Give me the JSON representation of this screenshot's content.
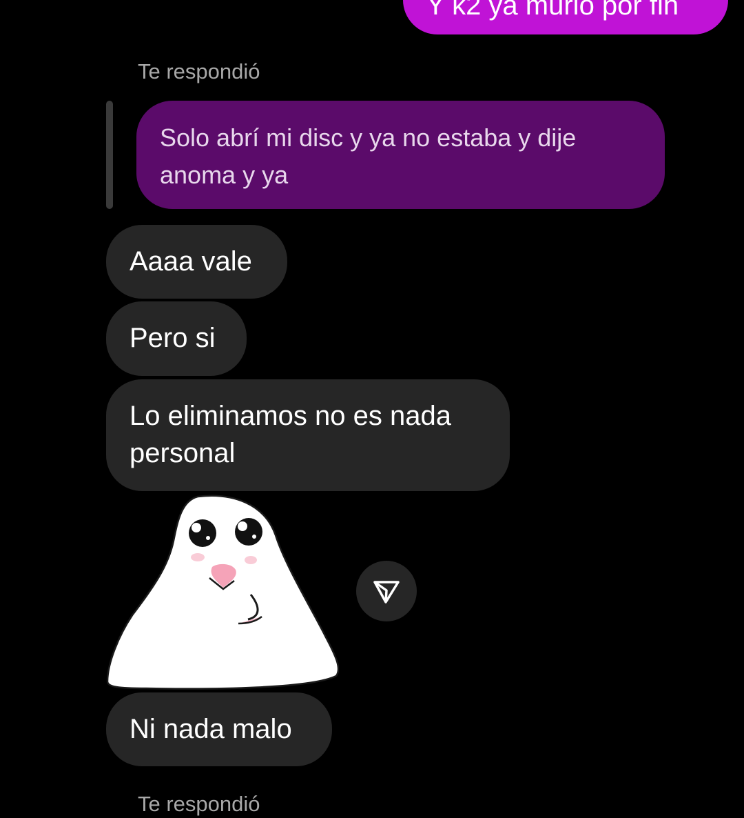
{
  "thread": {
    "sent_top_partial": "Y k2 ya murió por fin",
    "reply_label": "Te respondió",
    "quoted_message": "Solo abrí mi disc y ya no estaba y dije anoma y ya",
    "received": [
      "Aaaa vale",
      "Pero si",
      "Lo eliminamos no es nada personal",
      "Ni nada malo"
    ],
    "bottom_partial_label": "Te respondió"
  },
  "icons": {
    "share": "send-icon",
    "sticker": "white-blob-sticker"
  },
  "colors": {
    "background": "#000000",
    "sent_bubble": "#c013d6",
    "quoted_bubble": "#5b0b6a",
    "received_bubble": "#262626",
    "muted_text": "#a8a8a8"
  }
}
